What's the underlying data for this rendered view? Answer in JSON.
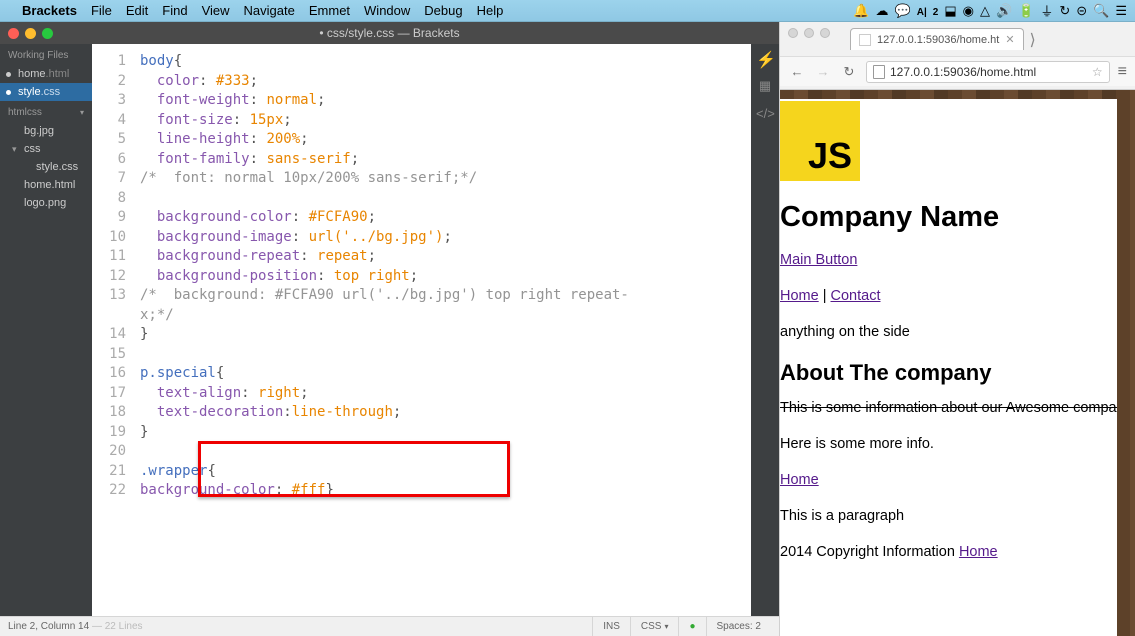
{
  "menubar": {
    "app": "Brackets",
    "items": [
      "File",
      "Edit",
      "Find",
      "View",
      "Navigate",
      "Emmet",
      "Window",
      "Debug",
      "Help"
    ]
  },
  "brackets": {
    "title": "• css/style.css — Brackets",
    "working_files_label": "Working Files",
    "working_files": [
      {
        "name": "home",
        "ext": ".html",
        "active": false
      },
      {
        "name": "style",
        "ext": ".css",
        "active": true
      }
    ],
    "project_name": "htmlcss",
    "tree": [
      {
        "name": "bg.jpg",
        "nested": false
      },
      {
        "name": "css",
        "nested": false,
        "folder": true
      },
      {
        "name": "style.css",
        "nested": true
      },
      {
        "name": "home.html",
        "nested": false
      },
      {
        "name": "logo.png",
        "nested": false
      }
    ],
    "code": [
      {
        "n": 1,
        "raw": [
          [
            "sel",
            "body"
          ],
          [
            "punct",
            "{"
          ]
        ]
      },
      {
        "n": 2,
        "raw": [
          [
            "ind",
            "  "
          ],
          [
            "prop",
            "color"
          ],
          [
            "punct",
            ": "
          ],
          [
            "val",
            "#333"
          ],
          [
            "punct",
            ";"
          ]
        ]
      },
      {
        "n": 3,
        "raw": [
          [
            "ind",
            "  "
          ],
          [
            "prop",
            "font-weight"
          ],
          [
            "punct",
            ": "
          ],
          [
            "val",
            "normal"
          ],
          [
            "punct",
            ";"
          ]
        ]
      },
      {
        "n": 4,
        "raw": [
          [
            "ind",
            "  "
          ],
          [
            "prop",
            "font-size"
          ],
          [
            "punct",
            ": "
          ],
          [
            "val",
            "15px"
          ],
          [
            "punct",
            ";"
          ]
        ]
      },
      {
        "n": 5,
        "raw": [
          [
            "ind",
            "  "
          ],
          [
            "prop",
            "line-height"
          ],
          [
            "punct",
            ": "
          ],
          [
            "val",
            "200%"
          ],
          [
            "punct",
            ";"
          ]
        ]
      },
      {
        "n": 6,
        "raw": [
          [
            "ind",
            "  "
          ],
          [
            "prop",
            "font-family"
          ],
          [
            "punct",
            ": "
          ],
          [
            "val",
            "sans-serif"
          ],
          [
            "punct",
            ";"
          ]
        ]
      },
      {
        "n": 7,
        "raw": [
          [
            "cmt",
            "/*  font: normal 10px/200% sans-serif;*/"
          ]
        ]
      },
      {
        "n": 8,
        "raw": [
          [
            "",
            ""
          ]
        ]
      },
      {
        "n": 9,
        "raw": [
          [
            "ind",
            "  "
          ],
          [
            "prop",
            "background-color"
          ],
          [
            "punct",
            ": "
          ],
          [
            "val",
            "#FCFA90"
          ],
          [
            "punct",
            ";"
          ]
        ]
      },
      {
        "n": 10,
        "raw": [
          [
            "ind",
            "  "
          ],
          [
            "prop",
            "background-image"
          ],
          [
            "punct",
            ": "
          ],
          [
            "val",
            "url('../bg.jpg')"
          ],
          [
            "punct",
            ";"
          ]
        ]
      },
      {
        "n": 11,
        "raw": [
          [
            "ind",
            "  "
          ],
          [
            "prop",
            "background-repeat"
          ],
          [
            "punct",
            ": "
          ],
          [
            "val",
            "repeat"
          ],
          [
            "punct",
            ";"
          ]
        ]
      },
      {
        "n": 12,
        "raw": [
          [
            "ind",
            "  "
          ],
          [
            "prop",
            "background-position"
          ],
          [
            "punct",
            ": "
          ],
          [
            "val",
            "top right"
          ],
          [
            "punct",
            ";"
          ]
        ]
      },
      {
        "n": 13,
        "raw": [
          [
            "cmt",
            "/*  background: #FCFA90 url('../bg.jpg') top right repeat-"
          ]
        ]
      },
      {
        "n": "",
        "raw": [
          [
            "cmt",
            "x;*/"
          ]
        ]
      },
      {
        "n": 14,
        "raw": [
          [
            "punct",
            "}"
          ]
        ]
      },
      {
        "n": 15,
        "raw": [
          [
            "",
            ""
          ]
        ]
      },
      {
        "n": 16,
        "raw": [
          [
            "sel",
            "p.special"
          ],
          [
            "punct",
            "{"
          ]
        ]
      },
      {
        "n": 17,
        "raw": [
          [
            "ind",
            "  "
          ],
          [
            "prop",
            "text-align"
          ],
          [
            "punct",
            ": "
          ],
          [
            "val",
            "right"
          ],
          [
            "punct",
            ";"
          ]
        ]
      },
      {
        "n": 18,
        "raw": [
          [
            "ind",
            "  "
          ],
          [
            "prop",
            "text-decoration"
          ],
          [
            "punct",
            ":"
          ],
          [
            "val",
            "line-through"
          ],
          [
            "punct",
            ";"
          ]
        ]
      },
      {
        "n": 19,
        "raw": [
          [
            "punct",
            "}"
          ]
        ]
      },
      {
        "n": 20,
        "raw": [
          [
            "",
            ""
          ]
        ]
      },
      {
        "n": 21,
        "raw": [
          [
            "sel",
            ".wrapper"
          ],
          [
            "punct",
            "{"
          ]
        ]
      },
      {
        "n": 22,
        "raw": [
          [
            "prop",
            "background-color"
          ],
          [
            "punct",
            ": "
          ],
          [
            "val",
            "#fff"
          ],
          [
            "punct",
            "}"
          ]
        ]
      }
    ],
    "status": {
      "cursor": "Line 2, Column 14",
      "lines": " — 22 Lines",
      "ins": "INS",
      "lang": "CSS",
      "spaces": "Spaces: 2"
    }
  },
  "chrome": {
    "tab_title": "127.0.0.1:59036/home.ht",
    "url": "127.0.0.1:59036/home.html",
    "page": {
      "logo_text": "JS",
      "h1": "Company Name",
      "main_button": "Main Button",
      "nav_home": "Home",
      "nav_sep": " | ",
      "nav_contact": "Contact",
      "side_text": "anything on the side",
      "h2": "About The company",
      "strike": "This is some information about our Awesome company",
      "more": "Here is some more info.",
      "home_link": "Home",
      "para": "This is a paragraph",
      "footer_text": "2014 Copyright Information ",
      "footer_link": "Home"
    }
  }
}
